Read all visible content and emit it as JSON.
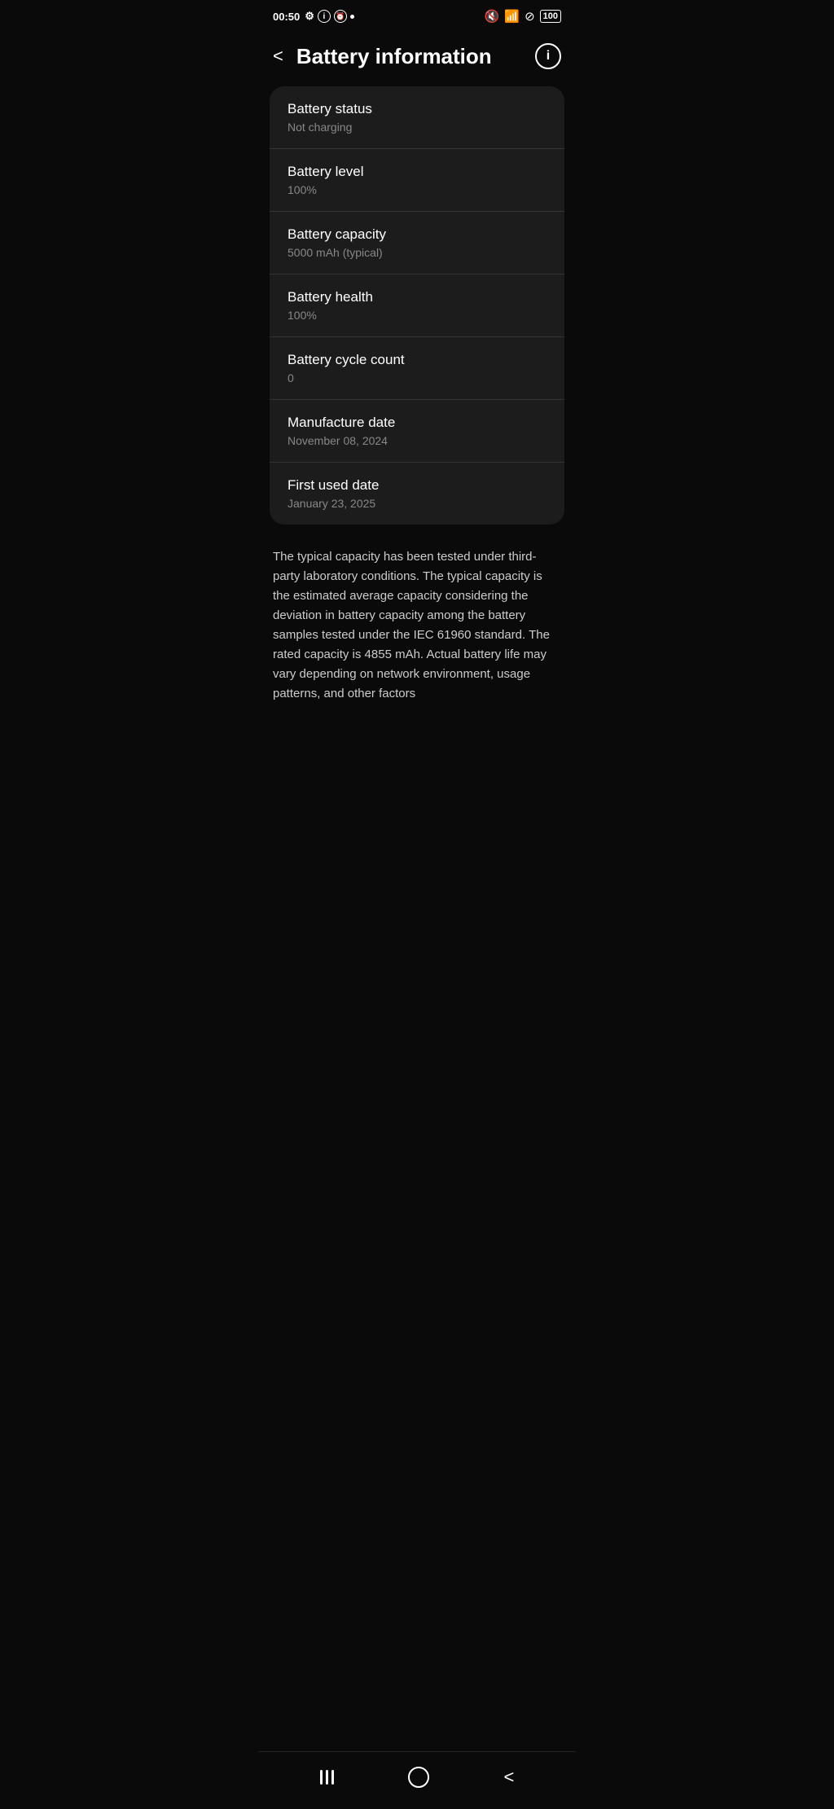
{
  "statusBar": {
    "time": "00:50",
    "batteryPercent": "100"
  },
  "header": {
    "backLabel": "<",
    "title": "Battery information",
    "infoLabel": "i"
  },
  "infoRows": [
    {
      "label": "Battery status",
      "value": "Not charging"
    },
    {
      "label": "Battery level",
      "value": "100%"
    },
    {
      "label": "Battery capacity",
      "value": "5000 mAh (typical)"
    },
    {
      "label": "Battery health",
      "value": "100%"
    },
    {
      "label": "Battery cycle count",
      "value": "0"
    },
    {
      "label": "Manufacture date",
      "value": "November 08, 2024"
    },
    {
      "label": "First used date",
      "value": "January 23, 2025"
    }
  ],
  "description": "The typical capacity has been tested under third-party laboratory conditions. The typical capacity is the estimated average capacity considering the deviation in battery capacity among the battery samples tested under the IEC 61960 standard. The rated capacity is 4855 mAh. Actual battery life may vary depending on network environment, usage patterns, and other factors",
  "bottomNav": {
    "recentLabel": "|||",
    "homeLabel": "○",
    "backLabel": "<"
  }
}
